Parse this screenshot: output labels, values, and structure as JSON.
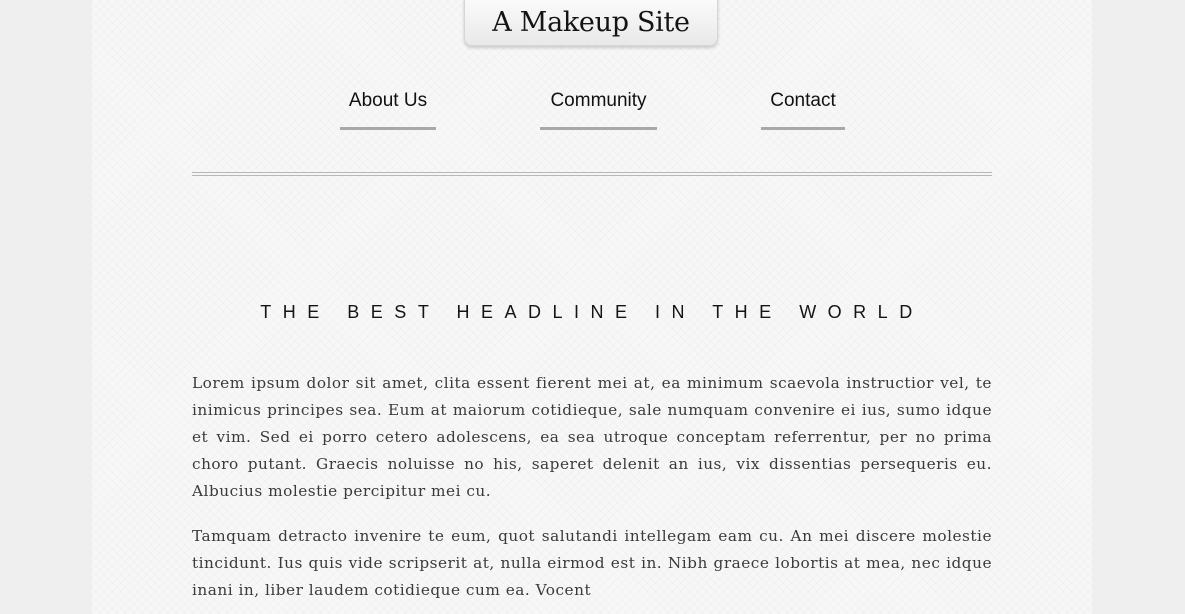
{
  "site": {
    "title": "A Makeup Site"
  },
  "nav": {
    "items": [
      {
        "label": "About Us"
      },
      {
        "label": "Community"
      },
      {
        "label": "Contact"
      }
    ]
  },
  "main": {
    "headline": "THE BEST HEADLINE IN THE WORLD",
    "paragraphs": [
      "Lorem ipsum dolor sit amet, clita essent fierent mei at, ea minimum scaevola instructior vel, te inimicus principes sea. Eum at maiorum cotidieque, sale numquam convenire ei ius, sumo idque et vim. Sed ei porro cetero adolescens, ea sea utroque conceptam referrentur, per no prima choro putant. Graecis noluisse no his, saperet delenit an ius, vix dissentias persequeris eu. Albucius molestie percipitur mei cu.",
      "Tamquam detracto invenire te eum, quot salutandi intellegam eam cu. An mei discere molestie tincidunt. Ius quis vide scripserit at, nulla eirmod est in. Nibh graece lobortis at mea, nec idque inani in, liber laudem cotidieque cum ea. Vocent"
    ]
  }
}
